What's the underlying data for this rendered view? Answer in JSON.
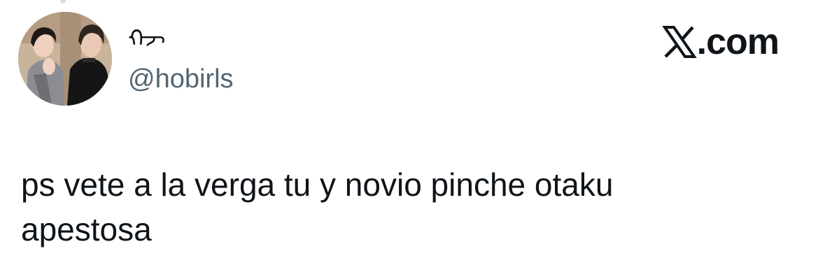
{
  "tweet": {
    "author": {
      "display_name": "ᡣᠵ",
      "handle": "@hobirls",
      "avatar_icon": "profile-photo"
    },
    "brand": {
      "logo_icon": "x-logo-icon",
      "domain_suffix": ".com"
    },
    "text_line_1": "ps vete a la verga tu y novio pinche otaku",
    "text_line_2": "apestosa"
  },
  "colors": {
    "text_primary": "#0f1419",
    "text_secondary": "#536471",
    "background": "#ffffff"
  }
}
